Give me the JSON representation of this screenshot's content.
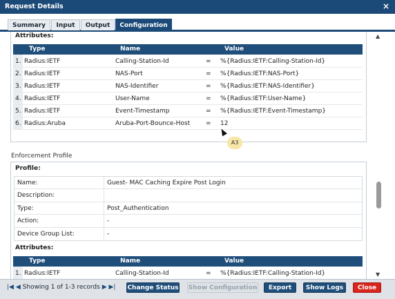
{
  "window": {
    "title": "Request Details"
  },
  "tabs": [
    {
      "label": "Summary"
    },
    {
      "label": "Input"
    },
    {
      "label": "Output"
    },
    {
      "label": "Configuration"
    }
  ],
  "attributes_section": {
    "heading": "Attributes:",
    "columns": [
      "Type",
      "Name",
      "Value"
    ],
    "rows": [
      {
        "num": "1.",
        "type": "Radius:IETF",
        "name": "Calling-Station-Id",
        "eq": "=",
        "value": "%{Radius:IETF:Calling-Station-Id}"
      },
      {
        "num": "2.",
        "type": "Radius:IETF",
        "name": "NAS-Port",
        "eq": "=",
        "value": "%{Radius:IETF:NAS-Port}"
      },
      {
        "num": "3.",
        "type": "Radius:IETF",
        "name": "NAS-Identifier",
        "eq": "=",
        "value": "%{Radius:IETF:NAS-Identifier}"
      },
      {
        "num": "4.",
        "type": "Radius:IETF",
        "name": "User-Name",
        "eq": "=",
        "value": "%{Radius:IETF:User-Name}"
      },
      {
        "num": "5.",
        "type": "Radius:IETF",
        "name": "Event-Timestamp",
        "eq": "=",
        "value": "%{Radius:IETF:Event-Timestamp}"
      },
      {
        "num": "6.",
        "type": "Radius:Aruba",
        "name": "Aruba-Port-Bounce-Host",
        "eq": "=",
        "value": "12"
      }
    ]
  },
  "enforcement_profile": {
    "section_label": "Enforcement Profile",
    "profile_heading": "Profile:",
    "fields": [
      {
        "label": "Name:",
        "value": "Guest- MAC Caching Expire Post Login"
      },
      {
        "label": "Description:",
        "value": ""
      },
      {
        "label": "Type:",
        "value": "Post_Authentication"
      },
      {
        "label": "Action:",
        "value": "-"
      },
      {
        "label": "Device Group List:",
        "value": "-"
      }
    ],
    "attributes_heading": "Attributes:",
    "columns": [
      "Type",
      "Name",
      "Value"
    ],
    "rows": [
      {
        "num": "1.",
        "type": "Radius:IETF",
        "name": "Calling-Station-Id",
        "eq": "=",
        "value": "%{Radius:IETF:Calling-Station-Id}"
      }
    ]
  },
  "cursor_badge": {
    "text": "A3"
  },
  "footer": {
    "pager": {
      "first": "|◀",
      "prev": "◀",
      "text": "Showing 1 of 1-3 records",
      "next": "▶",
      "last": "▶|"
    },
    "buttons": {
      "change_status": "Change Status",
      "show_configuration": "Show Configuration",
      "export": "Export",
      "show_logs": "Show Logs",
      "close": "Close"
    }
  },
  "colors": {
    "header_blue": "#1c4a78",
    "table_header": "#1f4e7a",
    "close_red": "#d9251c"
  },
  "icons": {
    "close": "close-icon",
    "scroll_up": "scroll-up-icon",
    "scroll_down": "scroll-down-icon"
  }
}
